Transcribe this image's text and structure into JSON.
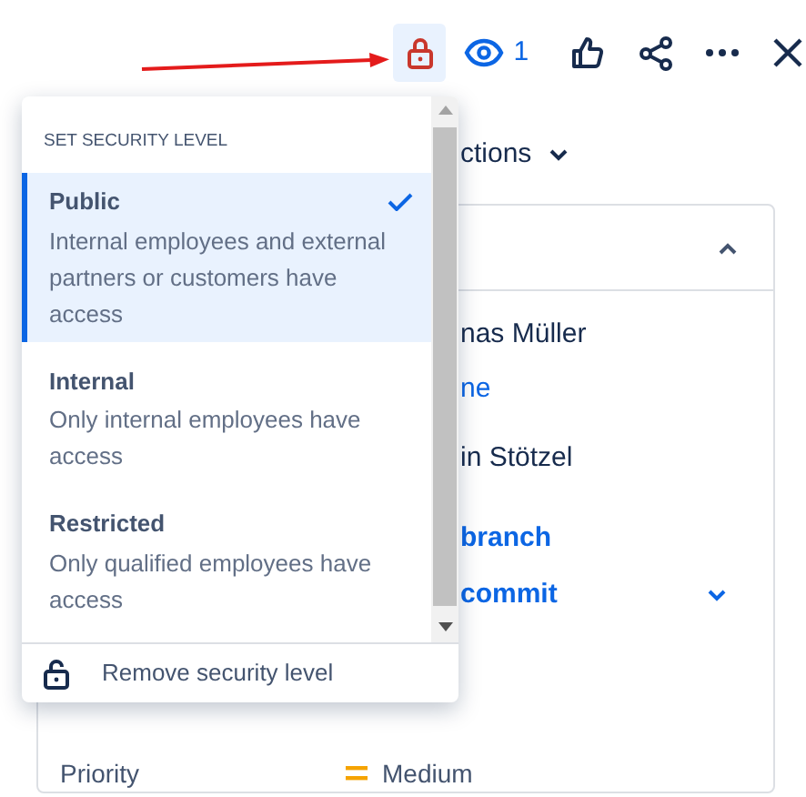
{
  "toolbar": {
    "security_set": true,
    "watch_count": "1"
  },
  "actions": {
    "label": "ctions"
  },
  "details": {
    "rows": [
      {
        "kind": "plain",
        "text": "nas Müller"
      },
      {
        "kind": "link",
        "text": "ne"
      },
      {
        "kind": "plain",
        "text": "in Stötzel"
      },
      {
        "kind": "strong-link",
        "text": "branch"
      },
      {
        "kind": "strong-link",
        "text": "commit",
        "expandable": true
      }
    ],
    "priority": {
      "label": "Priority",
      "value": "Medium"
    }
  },
  "security_menu": {
    "heading": "SET SECURITY LEVEL",
    "options": [
      {
        "title": "Public",
        "description": "Internal employees and external partners or customers have access",
        "selected": true
      },
      {
        "title": "Internal",
        "description": "Only internal employees have access",
        "selected": false
      },
      {
        "title": "Restricted",
        "description": "Only qualified employees have access",
        "selected": false
      }
    ],
    "remove": "Remove security level"
  }
}
